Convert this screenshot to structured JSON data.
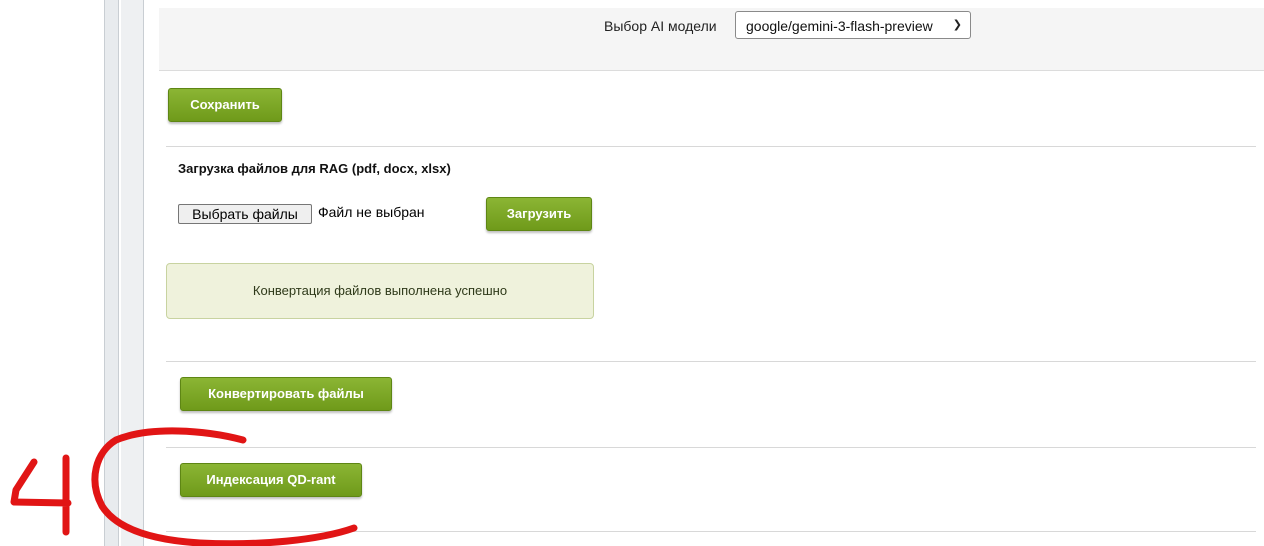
{
  "settings": {
    "model_label": "Выбор AI модели",
    "model_value": "google/gemini-3-flash-preview"
  },
  "buttons": {
    "save": "Сохранить",
    "upload": "Загрузить",
    "convert": "Конвертировать файлы",
    "index": "Индексация QD-rant"
  },
  "upload": {
    "title": "Загрузка файлов для RAG (pdf, docx, xlsx)",
    "choose_files": "Выбрать файлы",
    "no_file": "Файл не выбран"
  },
  "alert": {
    "message": "Конвертация файлов выполнена успешно"
  },
  "annotation": {
    "number": "4",
    "color": "#e11515"
  },
  "colors": {
    "button_green": "#7aa522",
    "alert_bg": "#eff2dc"
  }
}
